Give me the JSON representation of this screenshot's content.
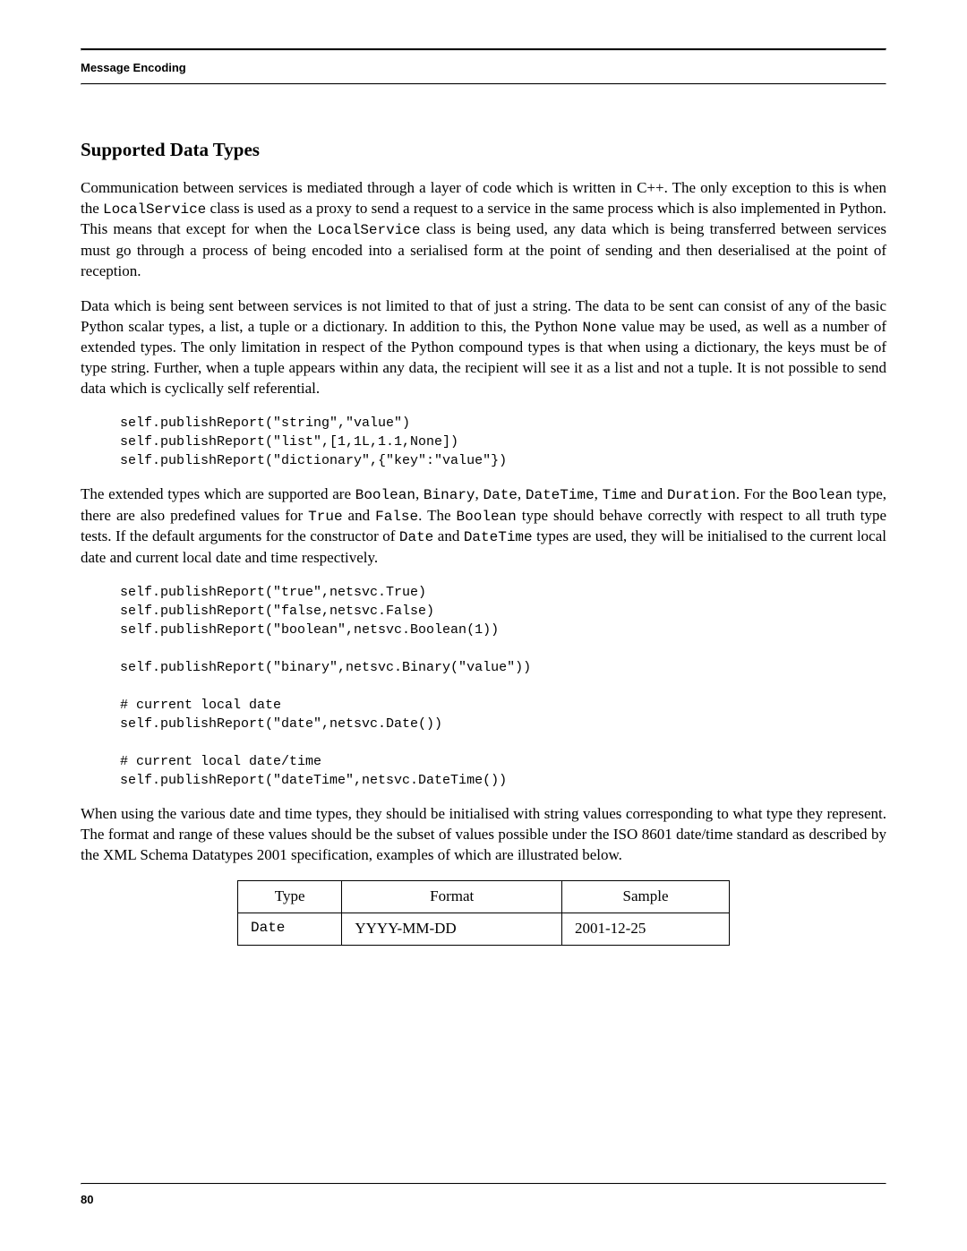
{
  "runningHead": "Message Encoding",
  "sectionTitle": "Supported Data Types",
  "para1": {
    "t0": "Communication between services is mediated through a layer of code which is written in C++. The only exception to this is when the ",
    "c0": "LocalService",
    "t1": " class is used as a proxy to send a request to a service in the same process which is also implemented in Python. This means that except for when the ",
    "c1": "LocalService",
    "t2": " class is being used, any data which is being transferred between services must go through a process of being encoded into a serialised form at the point of sending and then deserialised at the point of reception."
  },
  "para2": {
    "t0": "Data which is being sent between services is not limited to that of just a string. The data to be sent can consist of any of the basic Python scalar types, a list, a tuple or a dictionary. In addition to this, the Python ",
    "c0": "None",
    "t1": " value may be used, as well as a number of extended types. The only limitation in respect of the Python compound types is that when using a dictionary, the keys must be of type string. Further, when a tuple appears within any data, the recipient will see it as a list and not a tuple. It is not possible to send data which is cyclically self referential."
  },
  "code1": "self.publishReport(\"string\",\"value\")\nself.publishReport(\"list\",[1,1L,1.1,None])\nself.publishReport(\"dictionary\",{\"key\":\"value\"})",
  "para3": {
    "t0": "The extended types which are supported are ",
    "c0": "Boolean",
    "t1": ", ",
    "c1": "Binary",
    "t2": ", ",
    "c2": "Date",
    "t3": ", ",
    "c3": "DateTime",
    "t4": ", ",
    "c4": "Time",
    "t5": " and ",
    "c5": "Duration",
    "t6": ". For the ",
    "c6": "Boolean",
    "t7": " type, there are also predefined values for ",
    "c7": "True",
    "t8": " and ",
    "c8": "False",
    "t9": ". The ",
    "c9": "Boolean",
    "t10": " type should behave correctly with respect to all truth type tests. If the default arguments for the constructor of ",
    "c10": "Date",
    "t11": " and ",
    "c11": "DateTime",
    "t12": " types are used, they will be initialised to the current local date and current local date and time respectively."
  },
  "code2": "self.publishReport(\"true\",netsvc.True)\nself.publishReport(\"false,netsvc.False)\nself.publishReport(\"boolean\",netsvc.Boolean(1))\n\nself.publishReport(\"binary\",netsvc.Binary(\"value\"))\n\n# current local date\nself.publishReport(\"date\",netsvc.Date())\n\n# current local date/time\nself.publishReport(\"dateTime\",netsvc.DateTime())",
  "para4": "When using the various date and time types, they should be initialised with string values corresponding to what type they represent. The format and range of these values should be the subset of values possible under the ISO 8601 date/time standard as described by the XML Schema Datatypes 2001 specification, examples of which are illustrated below.",
  "table": {
    "headers": [
      "Type",
      "Format",
      "Sample"
    ],
    "rows": [
      {
        "type": "Date",
        "format": "YYYY-MM-DD",
        "sample": "2001-12-25"
      }
    ]
  },
  "pageNumber": "80"
}
